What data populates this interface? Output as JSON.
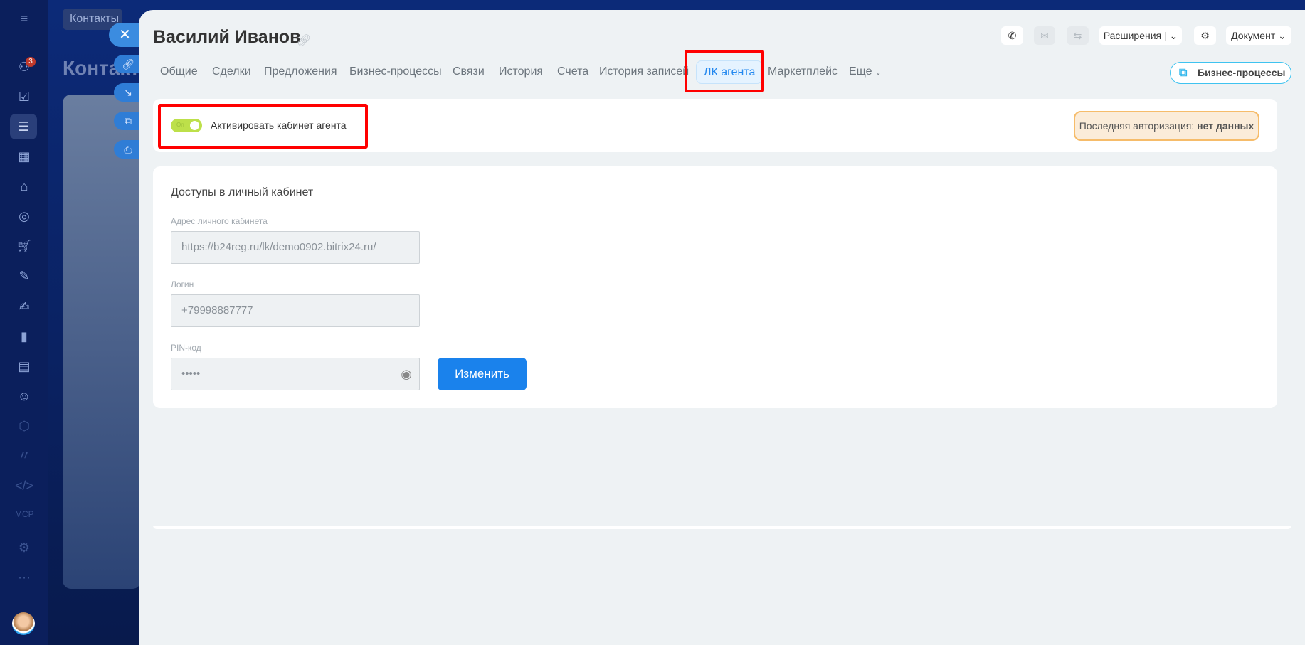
{
  "sidebar": {
    "notification_count": "3"
  },
  "background": {
    "breadcrumb": "Контакты",
    "heading": "Контакты"
  },
  "header": {
    "title": "Василий Иванов",
    "extensions_label": "Расширения",
    "document_label": "Документ",
    "bp_button": "Бизнес-процессы"
  },
  "tabs": [
    {
      "label": "Общие"
    },
    {
      "label": "Сделки"
    },
    {
      "label": "Предложения"
    },
    {
      "label": "Бизнес-процессы"
    },
    {
      "label": "Связи"
    },
    {
      "label": "История"
    },
    {
      "label": "Счета"
    },
    {
      "label": "История записей"
    },
    {
      "label": "ЛК агента",
      "active": true
    },
    {
      "label": "Маркетплейс"
    },
    {
      "label": "Еще"
    }
  ],
  "agent": {
    "toggle_on_text": "On",
    "toggle_label": "Активировать кабинет агента",
    "last_auth_label": "Последняя авторизация:",
    "last_auth_value": "нет данных",
    "toggle_state": true
  },
  "access": {
    "heading": "Доступы в личный кабинет",
    "address_label": "Адрес личного кабинета",
    "address_value": "https://b24reg.ru/lk/demo0902.bitrix24.ru/",
    "login_label": "Логин",
    "login_value": "+79998887777",
    "pin_label": "PIN-код",
    "pin_value": "•••••",
    "change_button": "Изменить"
  }
}
